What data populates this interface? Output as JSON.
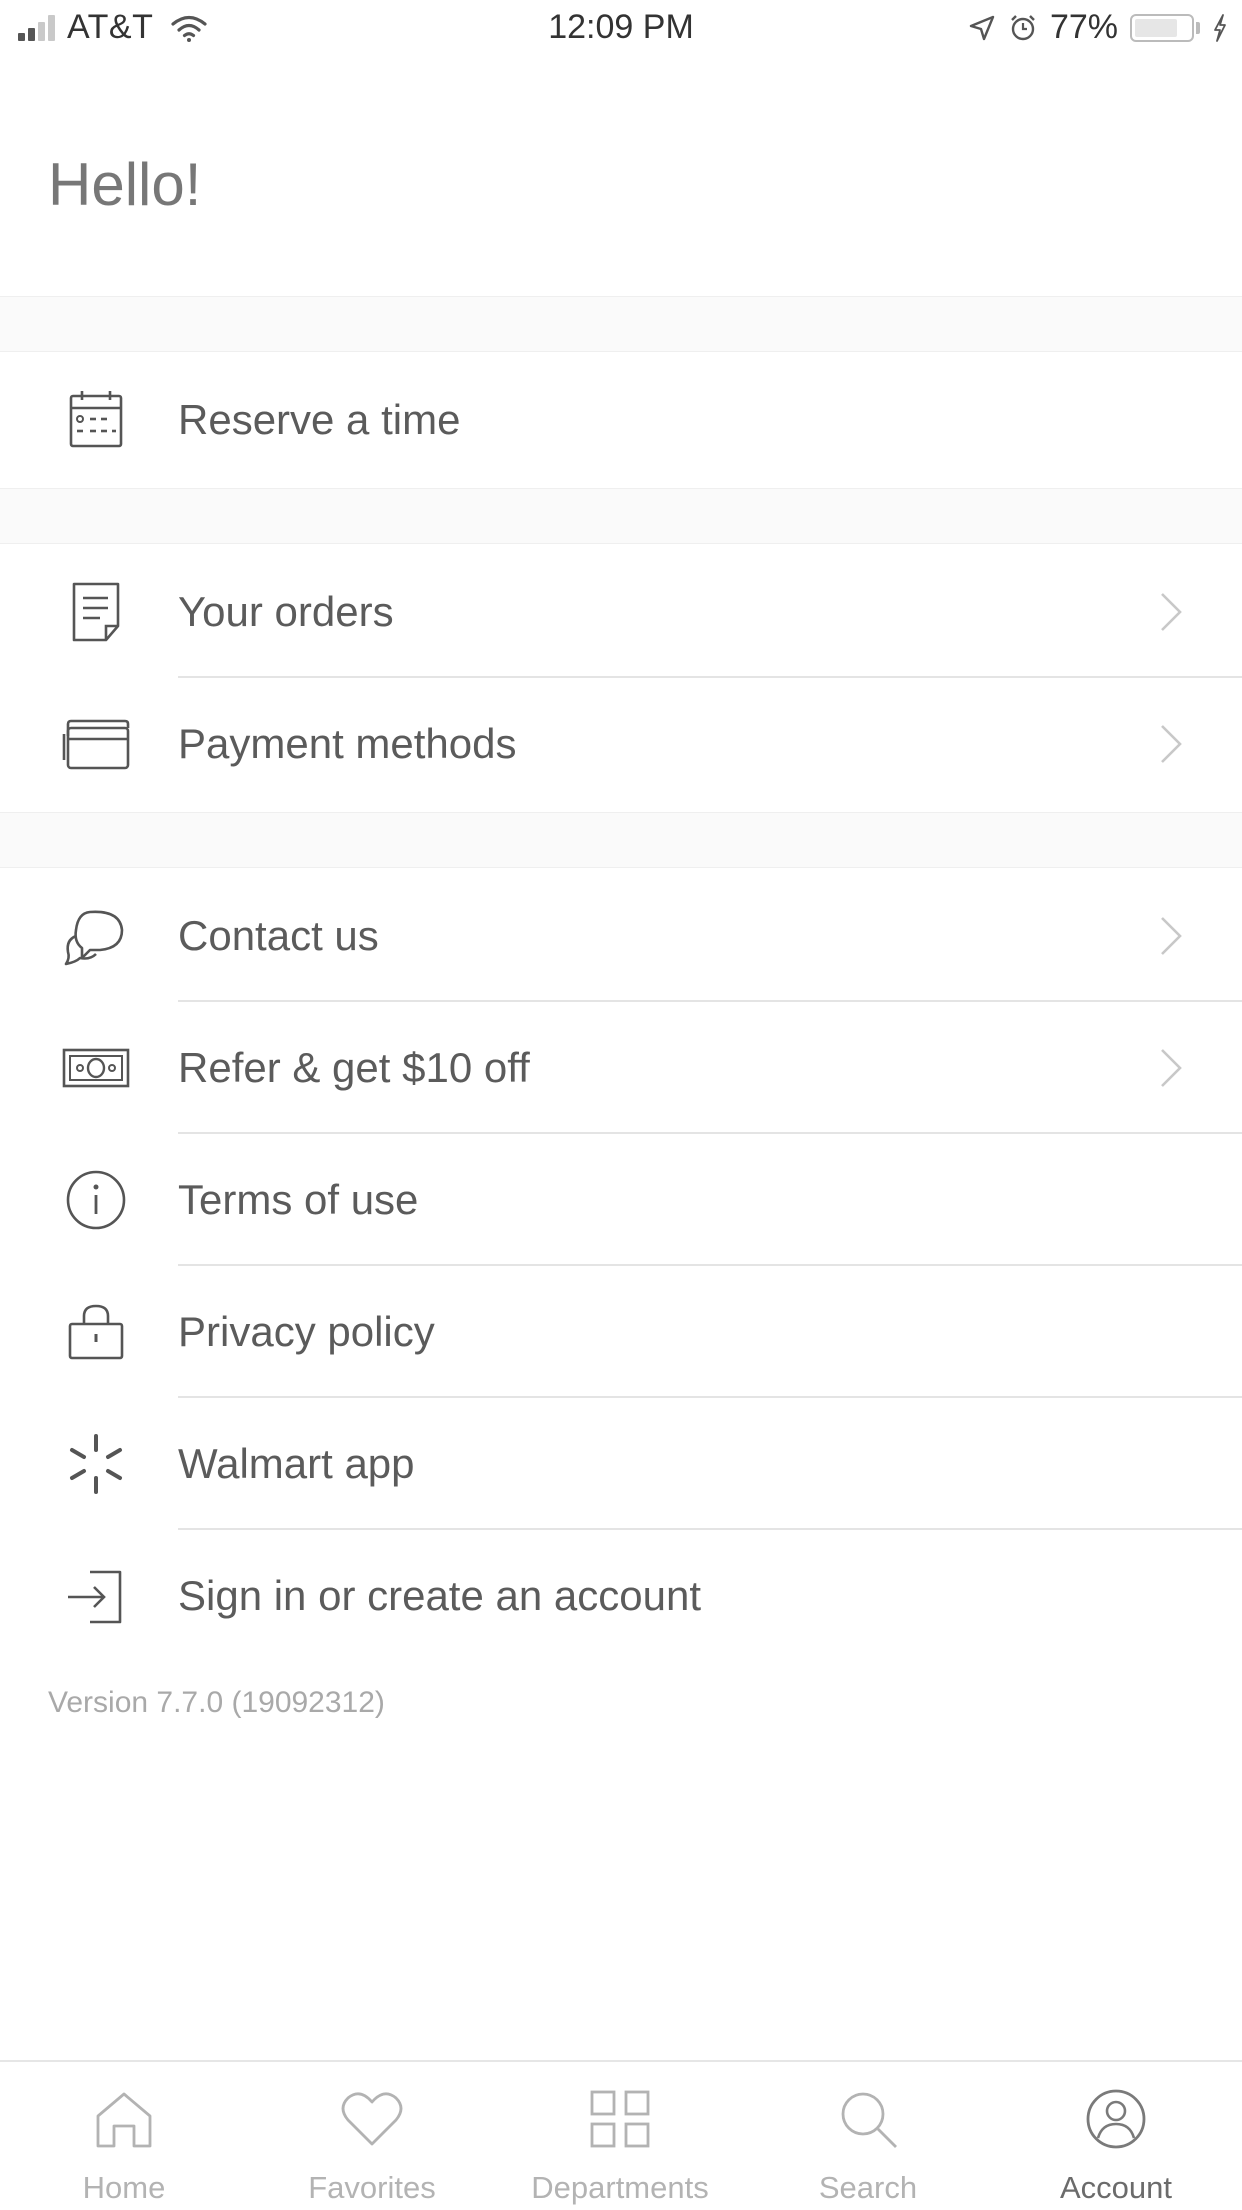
{
  "status_bar": {
    "carrier": "AT&T",
    "time": "12:09 PM",
    "battery": "77%",
    "battery_level": 0.77,
    "signal_bars_active": 2,
    "signal_bars_total": 4
  },
  "header": {
    "greeting": "Hello!"
  },
  "menu": {
    "reserve": {
      "label": "Reserve a time",
      "icon": "calendar-icon"
    },
    "orders": {
      "label": "Your orders",
      "icon": "receipt-icon"
    },
    "payment": {
      "label": "Payment methods",
      "icon": "credit-card-icon"
    },
    "contact": {
      "label": "Contact us",
      "icon": "chat-bubbles-icon"
    },
    "refer": {
      "label": "Refer & get $10 off",
      "icon": "money-bill-icon"
    },
    "terms": {
      "label": "Terms of use",
      "icon": "info-icon"
    },
    "privacy": {
      "label": "Privacy policy",
      "icon": "lock-icon"
    },
    "walmart": {
      "label": "Walmart app",
      "icon": "walmart-spark-icon"
    },
    "signin": {
      "label": "Sign in or create an account",
      "icon": "sign-in-icon"
    }
  },
  "version": "Version 7.7.0 (19092312)",
  "tab_bar": {
    "tabs": [
      {
        "label": "Home",
        "icon": "home-icon"
      },
      {
        "label": "Favorites",
        "icon": "heart-icon"
      },
      {
        "label": "Departments",
        "icon": "grid-icon"
      },
      {
        "label": "Search",
        "icon": "search-icon"
      },
      {
        "label": "Account",
        "icon": "account-icon"
      }
    ],
    "active": "Account"
  },
  "colors": {
    "text": "#5b5b5b",
    "icon_stroke": "#555555",
    "chevron": "#c8c8c8",
    "divider": "#e4e4e4",
    "tab_inactive": "#b3b3b3",
    "tab_active": "#6b6b6b"
  }
}
